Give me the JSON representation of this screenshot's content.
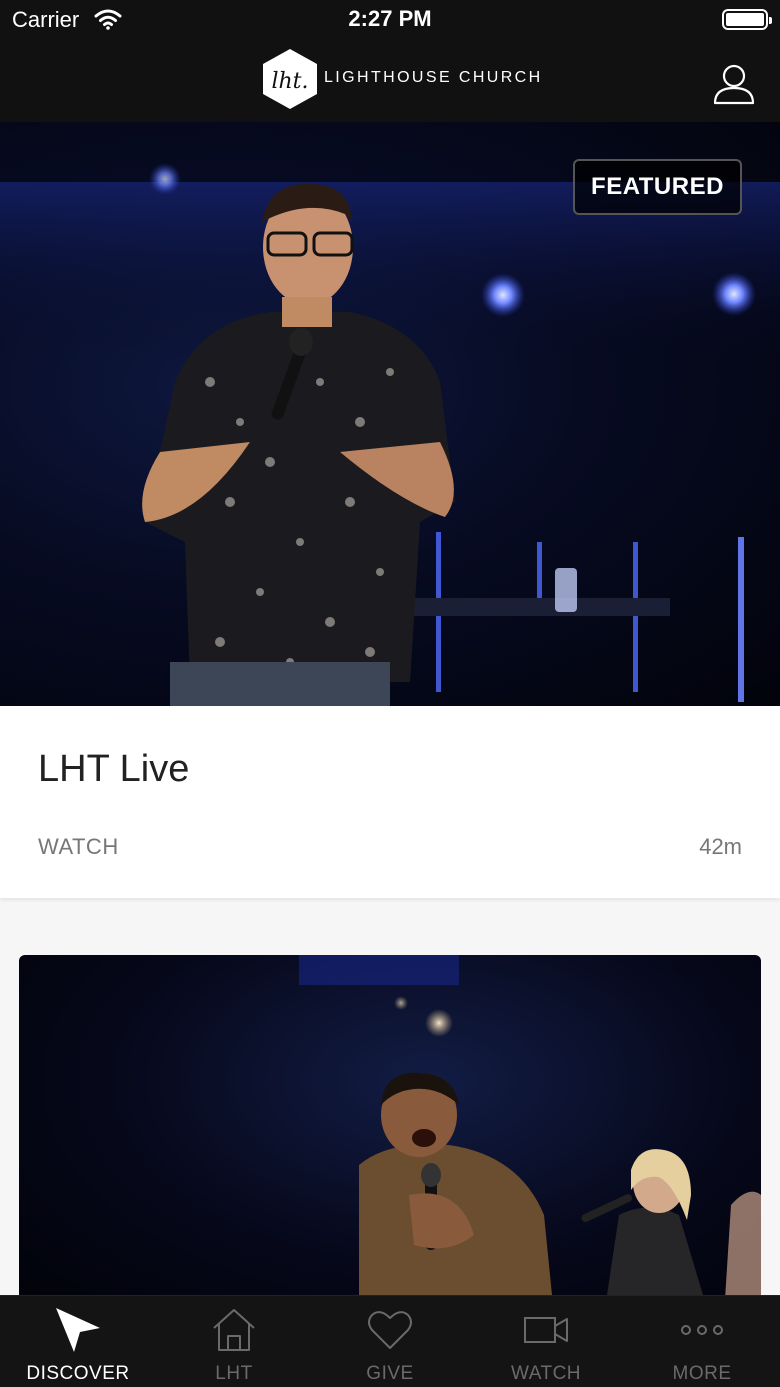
{
  "status_bar": {
    "carrier": "Carrier",
    "time": "2:27 PM"
  },
  "header": {
    "logo_text": "LIGHTHOUSE CHURCH",
    "logo_mark": "lht."
  },
  "featured": {
    "badge": "FEATURED",
    "title": "LHT Live",
    "action": "WATCH",
    "duration": "42m"
  },
  "tabs": [
    {
      "label": "DISCOVER",
      "icon": "navigation-arrow-icon",
      "active": true
    },
    {
      "label": "LHT",
      "icon": "home-icon",
      "active": false
    },
    {
      "label": "GIVE",
      "icon": "heart-icon",
      "active": false
    },
    {
      "label": "WATCH",
      "icon": "video-camera-icon",
      "active": false
    },
    {
      "label": "MORE",
      "icon": "more-dots-icon",
      "active": false
    }
  ],
  "colors": {
    "bar_background": "#111111",
    "active_tab": "#ffffff",
    "inactive_tab": "#6a6a6a"
  }
}
